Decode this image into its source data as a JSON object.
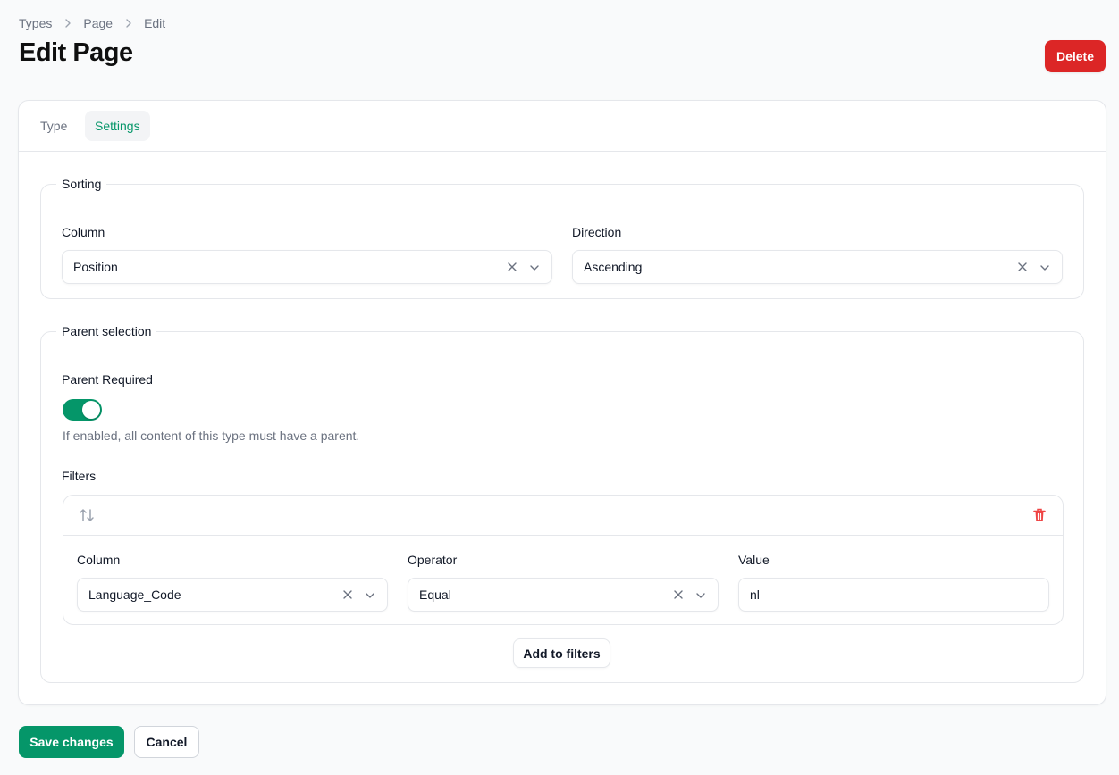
{
  "breadcrumb": [
    "Types",
    "Page",
    "Edit"
  ],
  "page_title": "Edit Page",
  "header": {
    "delete_label": "Delete"
  },
  "tabs": [
    {
      "label": "Type",
      "active": false
    },
    {
      "label": "Settings",
      "active": true
    }
  ],
  "sorting": {
    "legend": "Sorting",
    "column": {
      "label": "Column",
      "value": "Position"
    },
    "direction": {
      "label": "Direction",
      "value": "Ascending"
    }
  },
  "parent_selection": {
    "legend": "Parent selection",
    "parent_required": {
      "label": "Parent Required",
      "enabled": true
    },
    "helper": "If enabled, all content of this type must have a parent.",
    "filters_label": "Filters",
    "filter": {
      "column": {
        "label": "Column",
        "value": "Language_Code"
      },
      "operator": {
        "label": "Operator",
        "value": "Equal"
      },
      "value": {
        "label": "Value",
        "value": "nl"
      }
    },
    "add_label": "Add to filters"
  },
  "footer": {
    "save_label": "Save changes",
    "cancel_label": "Cancel"
  },
  "colors": {
    "primary": "#059669",
    "danger": "#dc2626",
    "border": "#e5e7eb"
  },
  "icons": [
    "chevron-right-icon",
    "clear-icon",
    "chevron-down-icon",
    "reorder-icon",
    "trash-icon"
  ]
}
